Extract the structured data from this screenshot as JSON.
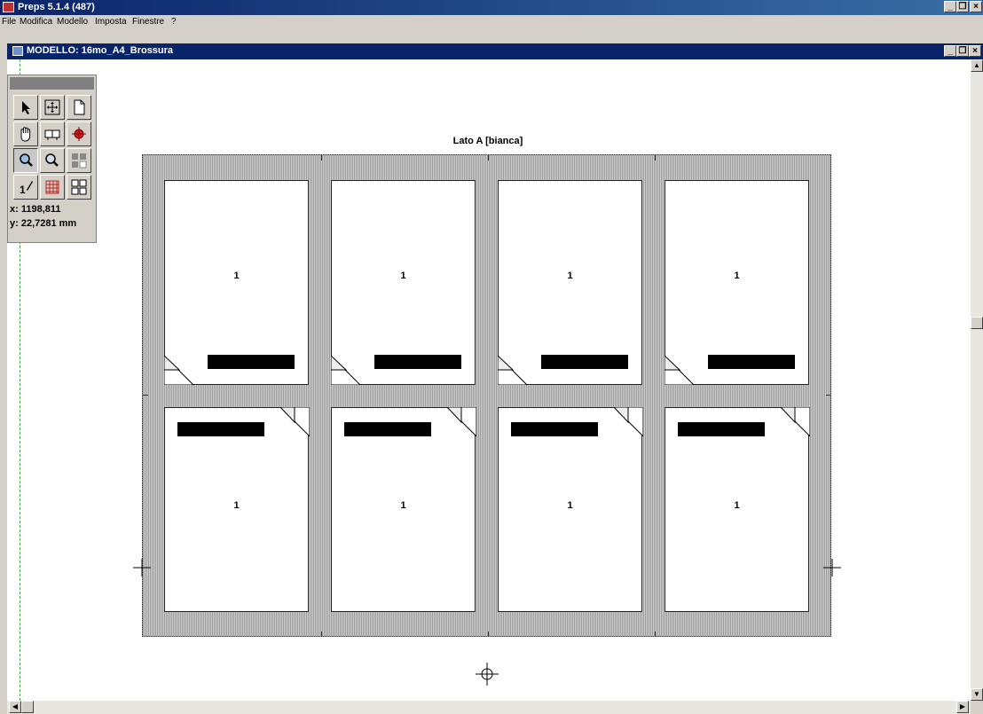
{
  "app": {
    "title": "Preps 5.1.4 (487)"
  },
  "menu": [
    "File",
    "Modifica",
    "Modello",
    "Imposta",
    "Finestre",
    "?"
  ],
  "document": {
    "title": "MODELLO: 16mo_A4_Brossura"
  },
  "window_buttons": {
    "minimize": "_",
    "restore": "❐",
    "close": "×"
  },
  "tools": [
    {
      "name": "arrow-select-icon"
    },
    {
      "name": "move-icon"
    },
    {
      "name": "page-icon"
    },
    {
      "name": "hand-icon"
    },
    {
      "name": "signature-icon"
    },
    {
      "name": "register-mark-icon"
    },
    {
      "name": "zoom-in-icon"
    },
    {
      "name": "zoom-out-icon"
    },
    {
      "name": "gutter-icon"
    },
    {
      "name": "page-number-icon"
    },
    {
      "name": "grid-icon"
    },
    {
      "name": "step-repeat-icon"
    }
  ],
  "coords": {
    "x": "x: 1198,811",
    "y": "y: 22,7281 mm"
  },
  "sheet": {
    "title": "Lato A [bianca]",
    "pages": [
      {
        "num": "1"
      },
      {
        "num": "1"
      },
      {
        "num": "1"
      },
      {
        "num": "1"
      },
      {
        "num": "1"
      },
      {
        "num": "1"
      },
      {
        "num": "1"
      },
      {
        "num": "1"
      }
    ]
  },
  "colors": {
    "titlebar": "#0a246a",
    "sheet": "#b8b8b8",
    "guide": "#4caf50"
  }
}
